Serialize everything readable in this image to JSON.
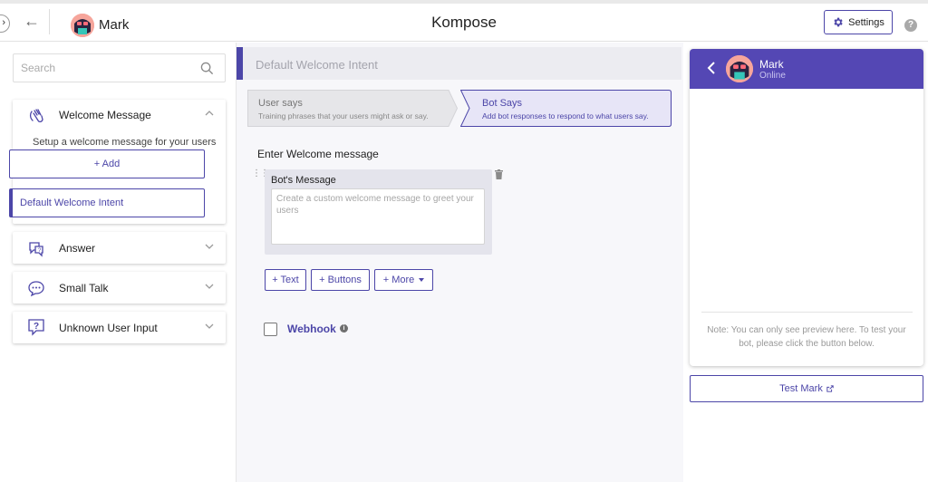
{
  "header": {
    "app_title": "Kompose",
    "bot_name": "Mark",
    "settings_label": "Settings",
    "help_icon": "question-icon"
  },
  "sidebar": {
    "search_placeholder": "Search",
    "sections": [
      {
        "title": "Welcome Message",
        "icon": "wave-hand-icon",
        "expanded": true,
        "subtitle": "Setup a welcome message for your users",
        "add_label": "+ Add",
        "intents": [
          "Default Welcome Intent"
        ]
      },
      {
        "title": "Answer",
        "icon": "chat-question-icon",
        "expanded": false
      },
      {
        "title": "Small Talk",
        "icon": "chat-dots-icon",
        "expanded": false
      },
      {
        "title": "Unknown User Input",
        "icon": "unknown-input-icon",
        "expanded": false
      }
    ]
  },
  "main": {
    "intent_title": "Default Welcome Intent",
    "steps": [
      {
        "title": "User says",
        "desc": "Training phrases that your users might ask or say.",
        "active": false
      },
      {
        "title": "Bot Says",
        "desc": "Add bot responses to respond to what users say.",
        "active": true
      }
    ],
    "enter_label": "Enter Welcome message",
    "message_card": {
      "title": "Bot's Message",
      "placeholder": "Create a custom welcome message to greet your users"
    },
    "buttons": {
      "text": "+ Text",
      "buttons": "+ Buttons",
      "more": "+ More"
    },
    "webhook_label": "Webhook"
  },
  "preview": {
    "bot_name": "Mark",
    "status": "Online",
    "note": "Note: You can only see preview here. To test your bot, please click the button below.",
    "test_label": "Test Mark"
  },
  "colors": {
    "accent": "#4c46a8",
    "preview_header": "#5447b4",
    "active_step_bg": "#e7e5f7"
  }
}
